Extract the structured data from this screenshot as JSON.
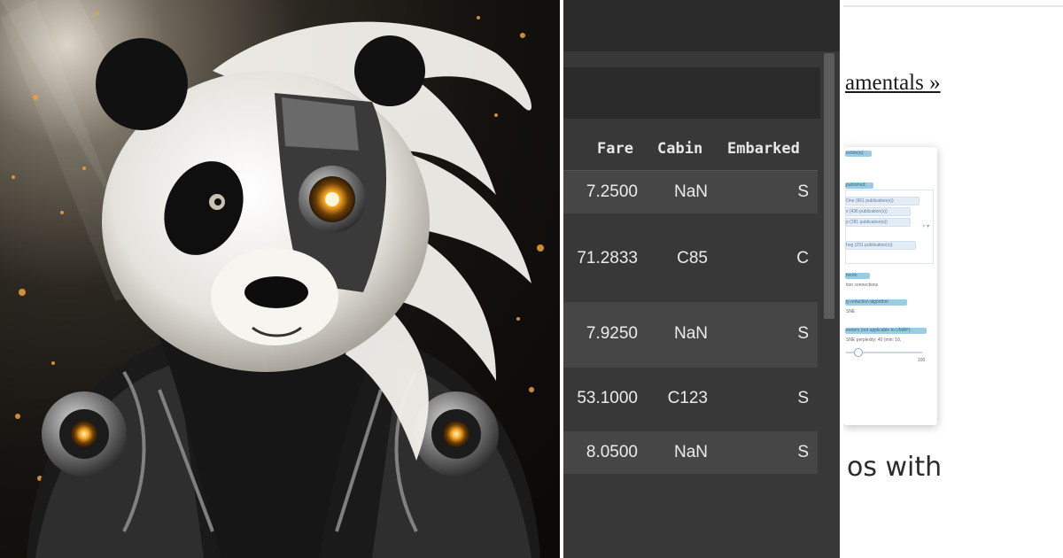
{
  "art": {
    "subject": "panda",
    "colors": {
      "background": "#14110e",
      "fur_white": "#f1efe9",
      "fur_black": "#141414",
      "metal": "#8c8c8c",
      "glow": "#f5a623"
    }
  },
  "dataframe": {
    "columns": [
      "Fare",
      "Cabin",
      "Embarked"
    ],
    "rows": [
      {
        "Fare": "7.2500",
        "Cabin": "NaN",
        "Embarked": "S"
      },
      {
        "Fare": "71.2833",
        "Cabin": "C85",
        "Embarked": "C"
      },
      {
        "Fare": "7.9250",
        "Cabin": "NaN",
        "Embarked": "S"
      },
      {
        "Fare": "53.1000",
        "Cabin": "C123",
        "Embarked": "S"
      },
      {
        "Fare": "8.0500",
        "Cabin": "NaN",
        "Embarked": "S"
      }
    ],
    "colors": {
      "bg": "#383838",
      "alt_row": "#464646",
      "bar": "#2b2b2b"
    }
  },
  "article": {
    "link_text": "amentals »",
    "card": {
      "line1": "ection(s):",
      "line2": "published:",
      "pills": [
        "One (961 publication(s))",
        "s (436 publication(s))",
        "p (281 publication(s))",
        "hog (231 publication(s))"
      ],
      "network_label": "twork:",
      "network_value": "tion connections",
      "algo_label": "ty reduction algorithm",
      "algo_value": "SNE",
      "params_label": "meters (not applicable to UMAP):",
      "params_value": "SNE perplexity: 40 (min: 10,",
      "slider_max": "100"
    },
    "bottom_text": "os with"
  }
}
